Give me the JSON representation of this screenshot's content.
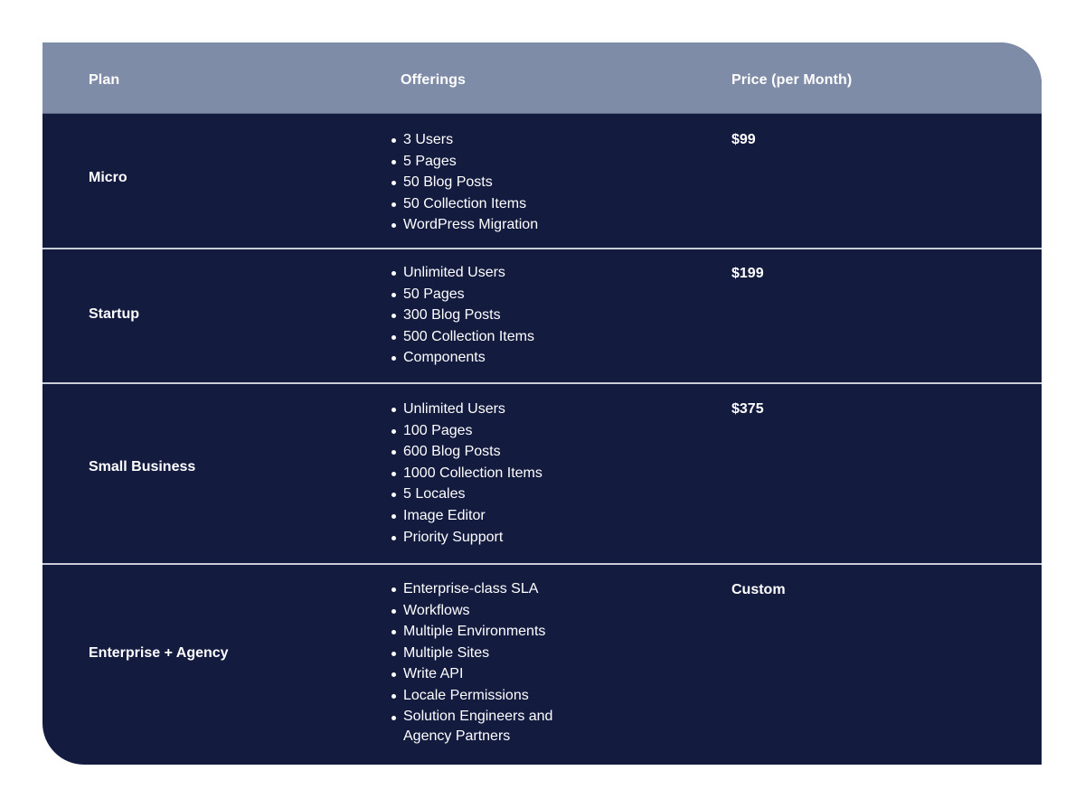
{
  "colors": {
    "header_bg": "#7f8ca8",
    "body_bg": "#131b3f",
    "divider": "#c9cdd8",
    "text": "#ffffff"
  },
  "table": {
    "headers": {
      "plan": "Plan",
      "offerings": "Offerings",
      "price": "Price (per Month)"
    },
    "rows": [
      {
        "plan": "Micro",
        "price": "$99",
        "offerings": [
          "3 Users",
          "5 Pages",
          "50 Blog Posts",
          "50 Collection Items",
          "WordPress Migration"
        ]
      },
      {
        "plan": "Startup",
        "price": "$199",
        "offerings": [
          "Unlimited Users",
          "50 Pages",
          "300 Blog Posts",
          "500 Collection Items",
          "Components"
        ]
      },
      {
        "plan": "Small Business",
        "price": "$375",
        "offerings": [
          "Unlimited Users",
          "100 Pages",
          "600 Blog Posts",
          "1000 Collection Items",
          "5 Locales",
          "Image Editor",
          "Priority Support"
        ]
      },
      {
        "plan": "Enterprise + Agency",
        "price": "Custom",
        "offerings": [
          "Enterprise-class SLA",
          "Workflows",
          "Multiple Environments",
          "Multiple Sites",
          "Write API",
          "Locale Permissions",
          "Solution Engineers and Agency Partners"
        ]
      }
    ]
  }
}
